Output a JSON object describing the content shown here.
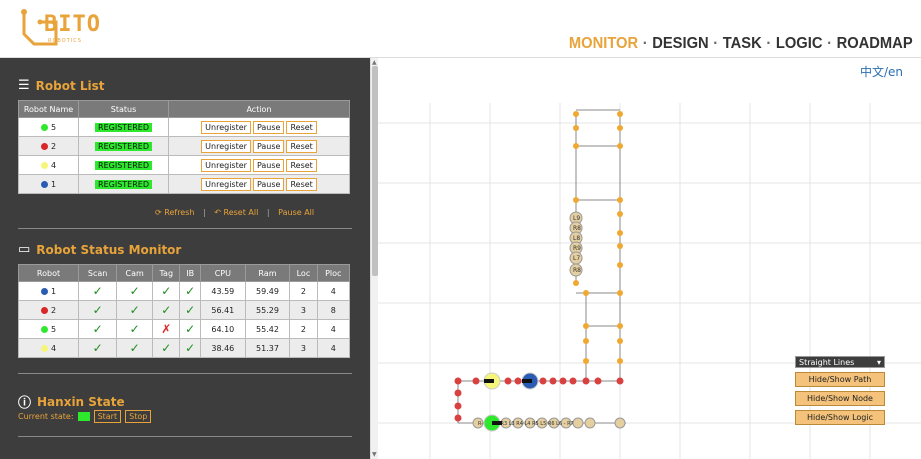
{
  "brand": {
    "name": "BITO",
    "sub": "ROBOTICS"
  },
  "nav": {
    "items": [
      "MONITOR",
      "DESIGN",
      "TASK",
      "LOGIC",
      "ROADMAP"
    ],
    "active": "MONITOR",
    "separator": "·"
  },
  "lang": "中文/en",
  "robot_list": {
    "title": "Robot List",
    "headers": [
      "Robot Name",
      "Status",
      "Action"
    ],
    "rows": [
      {
        "name": "5",
        "color": "#2ee82e",
        "status": "REGISTERED"
      },
      {
        "name": "2",
        "color": "#d92626",
        "status": "REGISTERED"
      },
      {
        "name": "4",
        "color": "#f5f57a",
        "status": "REGISTERED"
      },
      {
        "name": "1",
        "color": "#2a5cb4",
        "status": "REGISTERED"
      }
    ],
    "actions": [
      "Unregister",
      "Pause",
      "Reset"
    ],
    "links": {
      "refresh": "Refresh",
      "reset_all": "Reset All",
      "pause_all": "Pause All",
      "sep": "|"
    }
  },
  "status_monitor": {
    "title": "Robot Status Monitor",
    "headers": [
      "Robot",
      "Scan",
      "Cam",
      "Tag",
      "IB",
      "CPU",
      "Ram",
      "Loc",
      "Ploc"
    ],
    "rows": [
      {
        "robot": "1",
        "color": "#2a5cb4",
        "scan": "✓",
        "cam": "✓",
        "tag": "✓",
        "ib": "✓",
        "cpu": "43.59",
        "ram": "59.49",
        "loc": "2",
        "ploc": "4"
      },
      {
        "robot": "2",
        "color": "#d92626",
        "scan": "✓",
        "cam": "✓",
        "tag": "✓",
        "ib": "✓",
        "cpu": "56.41",
        "ram": "55.29",
        "loc": "3",
        "ploc": "8"
      },
      {
        "robot": "5",
        "color": "#2ee82e",
        "scan": "✓",
        "cam": "✓",
        "tag": "✗",
        "ib": "✓",
        "cpu": "64.10",
        "ram": "55.42",
        "loc": "2",
        "ploc": "4"
      },
      {
        "robot": "4",
        "color": "#f5f57a",
        "scan": "✓",
        "cam": "✓",
        "tag": "✓",
        "ib": "✓",
        "cpu": "38.46",
        "ram": "51.37",
        "loc": "3",
        "ploc": "4"
      }
    ]
  },
  "hanxin": {
    "title": "Hanxin State",
    "label": "Current state:",
    "start": "Start",
    "stop": "Stop"
  },
  "map": {
    "node_labels": [
      "L9",
      "R8",
      "L8",
      "R9",
      "L7",
      "R8"
    ],
    "bottom_labels": "R- R1 L2 R3 L3 R4 L4 R5 L5 R6 L6 - R7",
    "controls": {
      "line_mode": "Straight Lines",
      "path": "Hide/Show Path",
      "node": "Hide/Show Node",
      "logic": "Hide/Show Logic"
    }
  }
}
